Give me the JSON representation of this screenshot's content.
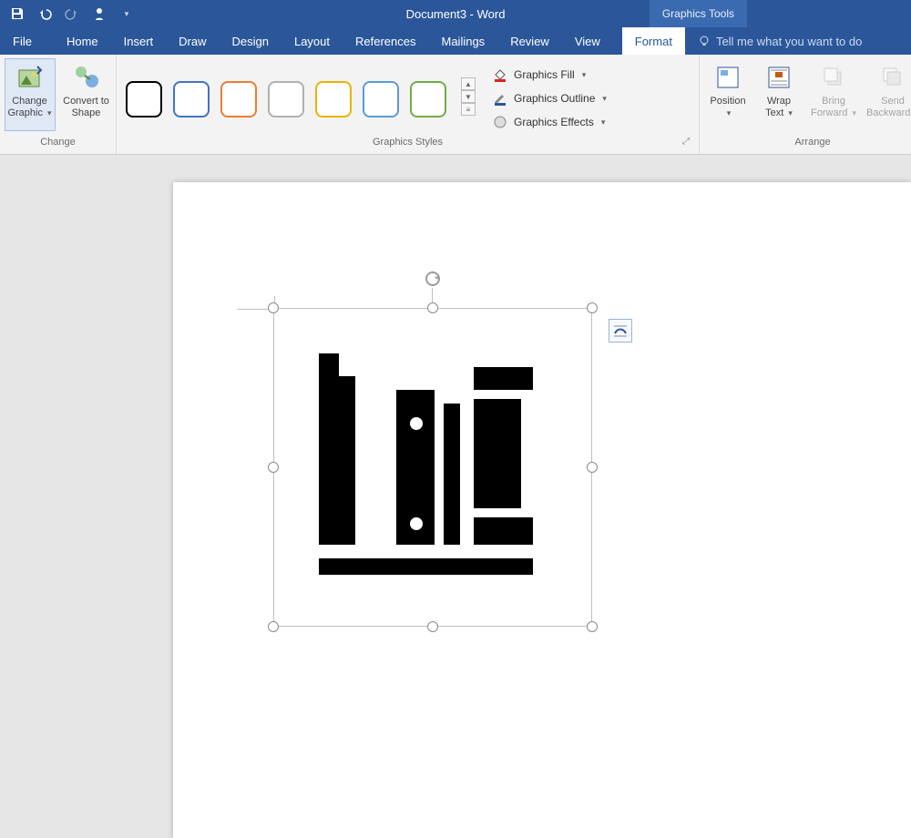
{
  "title": "Document3  -  Word",
  "contextual_tab": "Graphics Tools",
  "tabs": {
    "file": "File",
    "home": "Home",
    "insert": "Insert",
    "draw": "Draw",
    "design": "Design",
    "layout": "Layout",
    "references": "References",
    "mailings": "Mailings",
    "review": "Review",
    "view": "View",
    "format": "Format"
  },
  "tellme": "Tell me what you want to do",
  "ribbon": {
    "change": {
      "label": "Change",
      "change_graphic": "Change Graphic",
      "convert_to_shape": "Convert to Shape"
    },
    "styles": {
      "label": "Graphics Styles",
      "swatches": [
        {
          "name": "black",
          "color": "#000000"
        },
        {
          "name": "blue",
          "color": "#4472c4"
        },
        {
          "name": "orange",
          "color": "#ed7d31"
        },
        {
          "name": "gray",
          "color": "#b0b0b0"
        },
        {
          "name": "gold",
          "color": "#e7b500"
        },
        {
          "name": "lightblue",
          "color": "#5b9bd5"
        },
        {
          "name": "green",
          "color": "#70ad47"
        }
      ],
      "fill": "Graphics Fill",
      "outline": "Graphics Outline",
      "effects": "Graphics Effects"
    },
    "arrange": {
      "label": "Arrange",
      "position": "Position",
      "wrap_text": "Wrap Text",
      "bring_forward": "Bring Forward",
      "send_backward": "Send Backward"
    }
  },
  "canvas": {
    "selected_graphic": "books-icon"
  }
}
